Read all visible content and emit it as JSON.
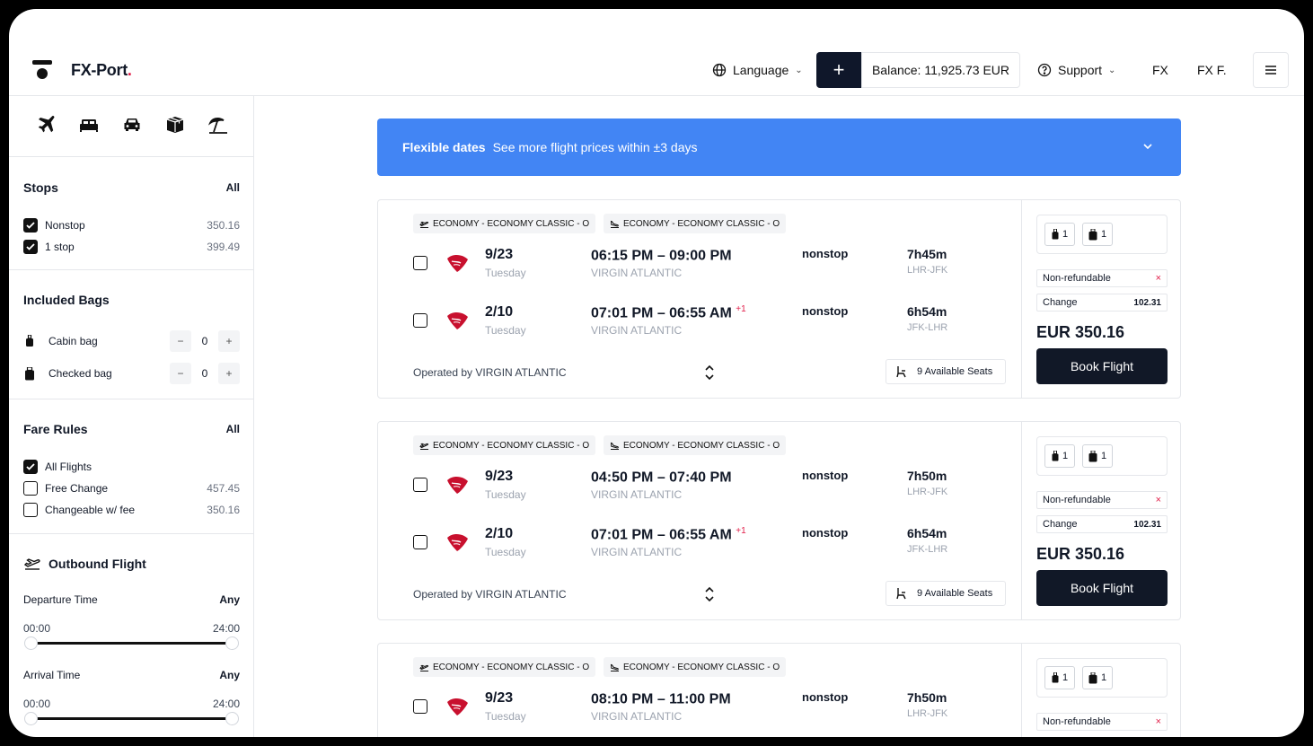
{
  "header": {
    "brand": "FX-Port",
    "brand_dot": ".",
    "language_label": "Language",
    "plus_label": "+",
    "balance": "Balance: 11,925.73 EUR",
    "support_label": "Support",
    "fx_label": "FX",
    "user_label": "FX F."
  },
  "sidebar": {
    "categories": [
      "plane-icon",
      "bed-icon",
      "car-icon",
      "package-icon",
      "beach-icon"
    ],
    "stops": {
      "title": "Stops",
      "all": "All",
      "items": [
        {
          "label": "Nonstop",
          "value": "350.16",
          "checked": true
        },
        {
          "label": "1 stop",
          "value": "399.49",
          "checked": true
        }
      ]
    },
    "bags": {
      "title": "Included Bags",
      "items": [
        {
          "label": "Cabin bag",
          "count": "0"
        },
        {
          "label": "Checked bag",
          "count": "0"
        }
      ],
      "minus": "−",
      "plus": "+"
    },
    "fare_rules": {
      "title": "Fare Rules",
      "all": "All",
      "items": [
        {
          "label": "All Flights",
          "value": "",
          "checked": true
        },
        {
          "label": "Free Change",
          "value": "457.45",
          "checked": false
        },
        {
          "label": "Changeable w/ fee",
          "value": "350.16",
          "checked": false
        }
      ]
    },
    "outbound": {
      "title": "Outbound Flight",
      "departure": {
        "label": "Departure Time",
        "any": "Any",
        "min": "00:00",
        "max": "24:00"
      },
      "arrival": {
        "label": "Arrival Time",
        "any": "Any",
        "min": "00:00",
        "max": "24:00"
      }
    }
  },
  "banner": {
    "title": "Flexible dates",
    "text": "See more flight prices within ±3 days"
  },
  "results": [
    {
      "tags": [
        "ECONOMY - ECONOMY CLASSIC - O",
        "ECONOMY - ECONOMY CLASSIC - O"
      ],
      "legs": [
        {
          "date": "9/23",
          "day": "Tuesday",
          "time": "06:15 PM – 09:00 PM",
          "plus": "",
          "carrier": "VIRGIN ATLANTIC",
          "stops": "nonstop",
          "duration": "7h45m",
          "route": "LHR-JFK"
        },
        {
          "date": "2/10",
          "day": "Tuesday",
          "time": "07:01 PM – 06:55 AM",
          "plus": "+1",
          "carrier": "VIRGIN ATLANTIC",
          "stops": "nonstop",
          "duration": "6h54m",
          "route": "JFK-LHR"
        }
      ],
      "operated": "Operated by VIRGIN ATLANTIC",
      "seats": "9 Available Seats",
      "cabin_bags": "1",
      "checked_bags": "1",
      "refund_label": "Non-refundable",
      "refund_mark": "×",
      "change_label": "Change",
      "change_value": "102.31",
      "price": "EUR 350.16",
      "book_label": "Book Flight"
    },
    {
      "tags": [
        "ECONOMY - ECONOMY CLASSIC - O",
        "ECONOMY - ECONOMY CLASSIC - O"
      ],
      "legs": [
        {
          "date": "9/23",
          "day": "Tuesday",
          "time": "04:50 PM – 07:40 PM",
          "plus": "",
          "carrier": "VIRGIN ATLANTIC",
          "stops": "nonstop",
          "duration": "7h50m",
          "route": "LHR-JFK"
        },
        {
          "date": "2/10",
          "day": "Tuesday",
          "time": "07:01 PM – 06:55 AM",
          "plus": "+1",
          "carrier": "VIRGIN ATLANTIC",
          "stops": "nonstop",
          "duration": "6h54m",
          "route": "JFK-LHR"
        }
      ],
      "operated": "Operated by VIRGIN ATLANTIC",
      "seats": "9 Available Seats",
      "cabin_bags": "1",
      "checked_bags": "1",
      "refund_label": "Non-refundable",
      "refund_mark": "×",
      "change_label": "Change",
      "change_value": "102.31",
      "price": "EUR 350.16",
      "book_label": "Book Flight"
    },
    {
      "tags": [
        "ECONOMY - ECONOMY CLASSIC - O",
        "ECONOMY - ECONOMY CLASSIC - O"
      ],
      "legs": [
        {
          "date": "9/23",
          "day": "Tuesday",
          "time": "08:10 PM – 11:00 PM",
          "plus": "",
          "carrier": "VIRGIN ATLANTIC",
          "stops": "nonstop",
          "duration": "7h50m",
          "route": "LHR-JFK"
        }
      ],
      "cabin_bags": "1",
      "checked_bags": "1",
      "refund_label": "Non-refundable",
      "refund_mark": "×"
    }
  ]
}
